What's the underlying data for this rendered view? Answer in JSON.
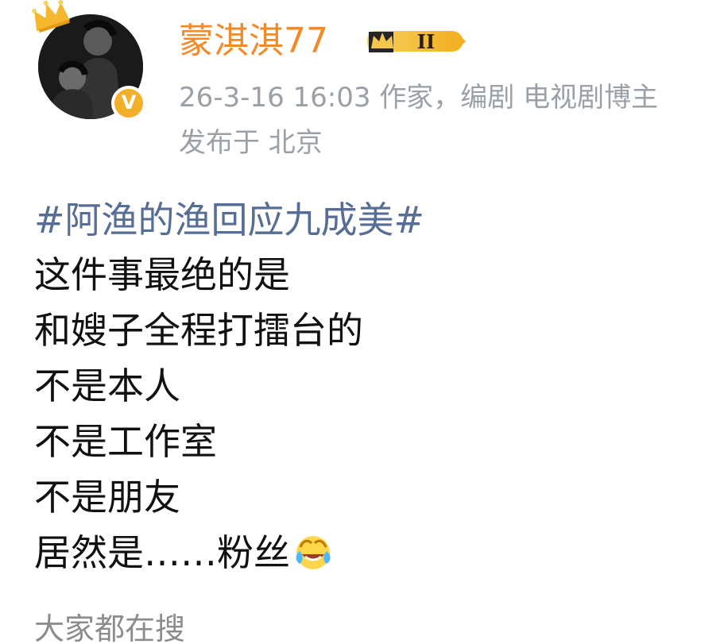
{
  "post": {
    "author": {
      "name": "蒙淇淇77",
      "avatar_icon": "portrait-avatar",
      "crown_icon": "crown-icon",
      "verified_icon": "verified-badge-icon",
      "vip_badge": {
        "label": "II",
        "icon": "vip-crown-badge",
        "accent_color": "#f3b129"
      }
    },
    "meta": {
      "timestamp": "26-3-16 16:03",
      "profile_note": "作家，编剧 电视剧博主",
      "location": "发布于 北京"
    },
    "text": {
      "hashtag": "#阿渔的渔回应九成美#",
      "lines": [
        "这件事最绝的是",
        "和嫂子全程打擂台的",
        "不是本人",
        "不是工作室",
        "不是朋友",
        "居然是……粉丝"
      ],
      "emoji": "laugh-cry-icon"
    },
    "footer": {
      "label": "大家都在搜"
    },
    "colors": {
      "username": "#f28a2a",
      "meta": "#9aa0a6",
      "hashtag": "#566d95",
      "body": "#111111"
    }
  }
}
